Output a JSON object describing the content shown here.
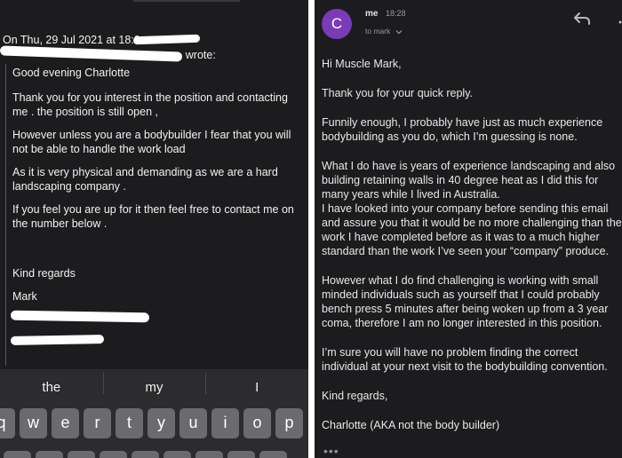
{
  "left": {
    "quote_date": "On Thu, 29 Jul 2021 at 18:0",
    "quote_wrote": "> wrote:",
    "greeting": "Good evening Charlotte",
    "para1": "Thank you for you interest in the position and contacting me . the position is still open ,",
    "para2": "However unless you are a bodybuilder I fear that you will not be able to handle the work load",
    "para3": "As it is very physical and demanding as we are a hard landscaping company .",
    "para4": "If you feel you are up for it then feel free to contact me on the number below .",
    "signoff": "Kind regards",
    "name": "Mark"
  },
  "keyboard": {
    "suggestions": [
      "the",
      "my",
      "I"
    ],
    "row1": [
      "q",
      "w",
      "e",
      "r",
      "t",
      "y",
      "u",
      "i",
      "o",
      "p"
    ]
  },
  "right": {
    "avatar_letter": "C",
    "sender": "me",
    "time": "18:28",
    "to": "to mark",
    "paragraphs": [
      "Hi Muscle Mark,",
      "Thank you for your quick reply.",
      "Funnily enough, I probably have just as much experience bodybuilding as you do, which I’m guessing is none.",
      "What I do have is years of experience landscaping and also building retaining walls in 40 degree heat as I did this for many years while I lived in Australia.",
      "I have looked into your company before sending this email and assure you that it would be no more challenging than the work I have completed before as it was to a much higher standard than the work I’ve seen your “company” produce.",
      "However what I do find challenging is working with small minded individuals such as yourself that I could probably bench press 5 minutes after being woken up from a 3 year coma, therefore I am no longer interested in this position.",
      "I’m sure you will have no problem finding the correct individual at your next visit to the bodybuilding convention.",
      "Kind regards,",
      "Charlotte (AKA not the body builder)"
    ],
    "more": "•••"
  }
}
